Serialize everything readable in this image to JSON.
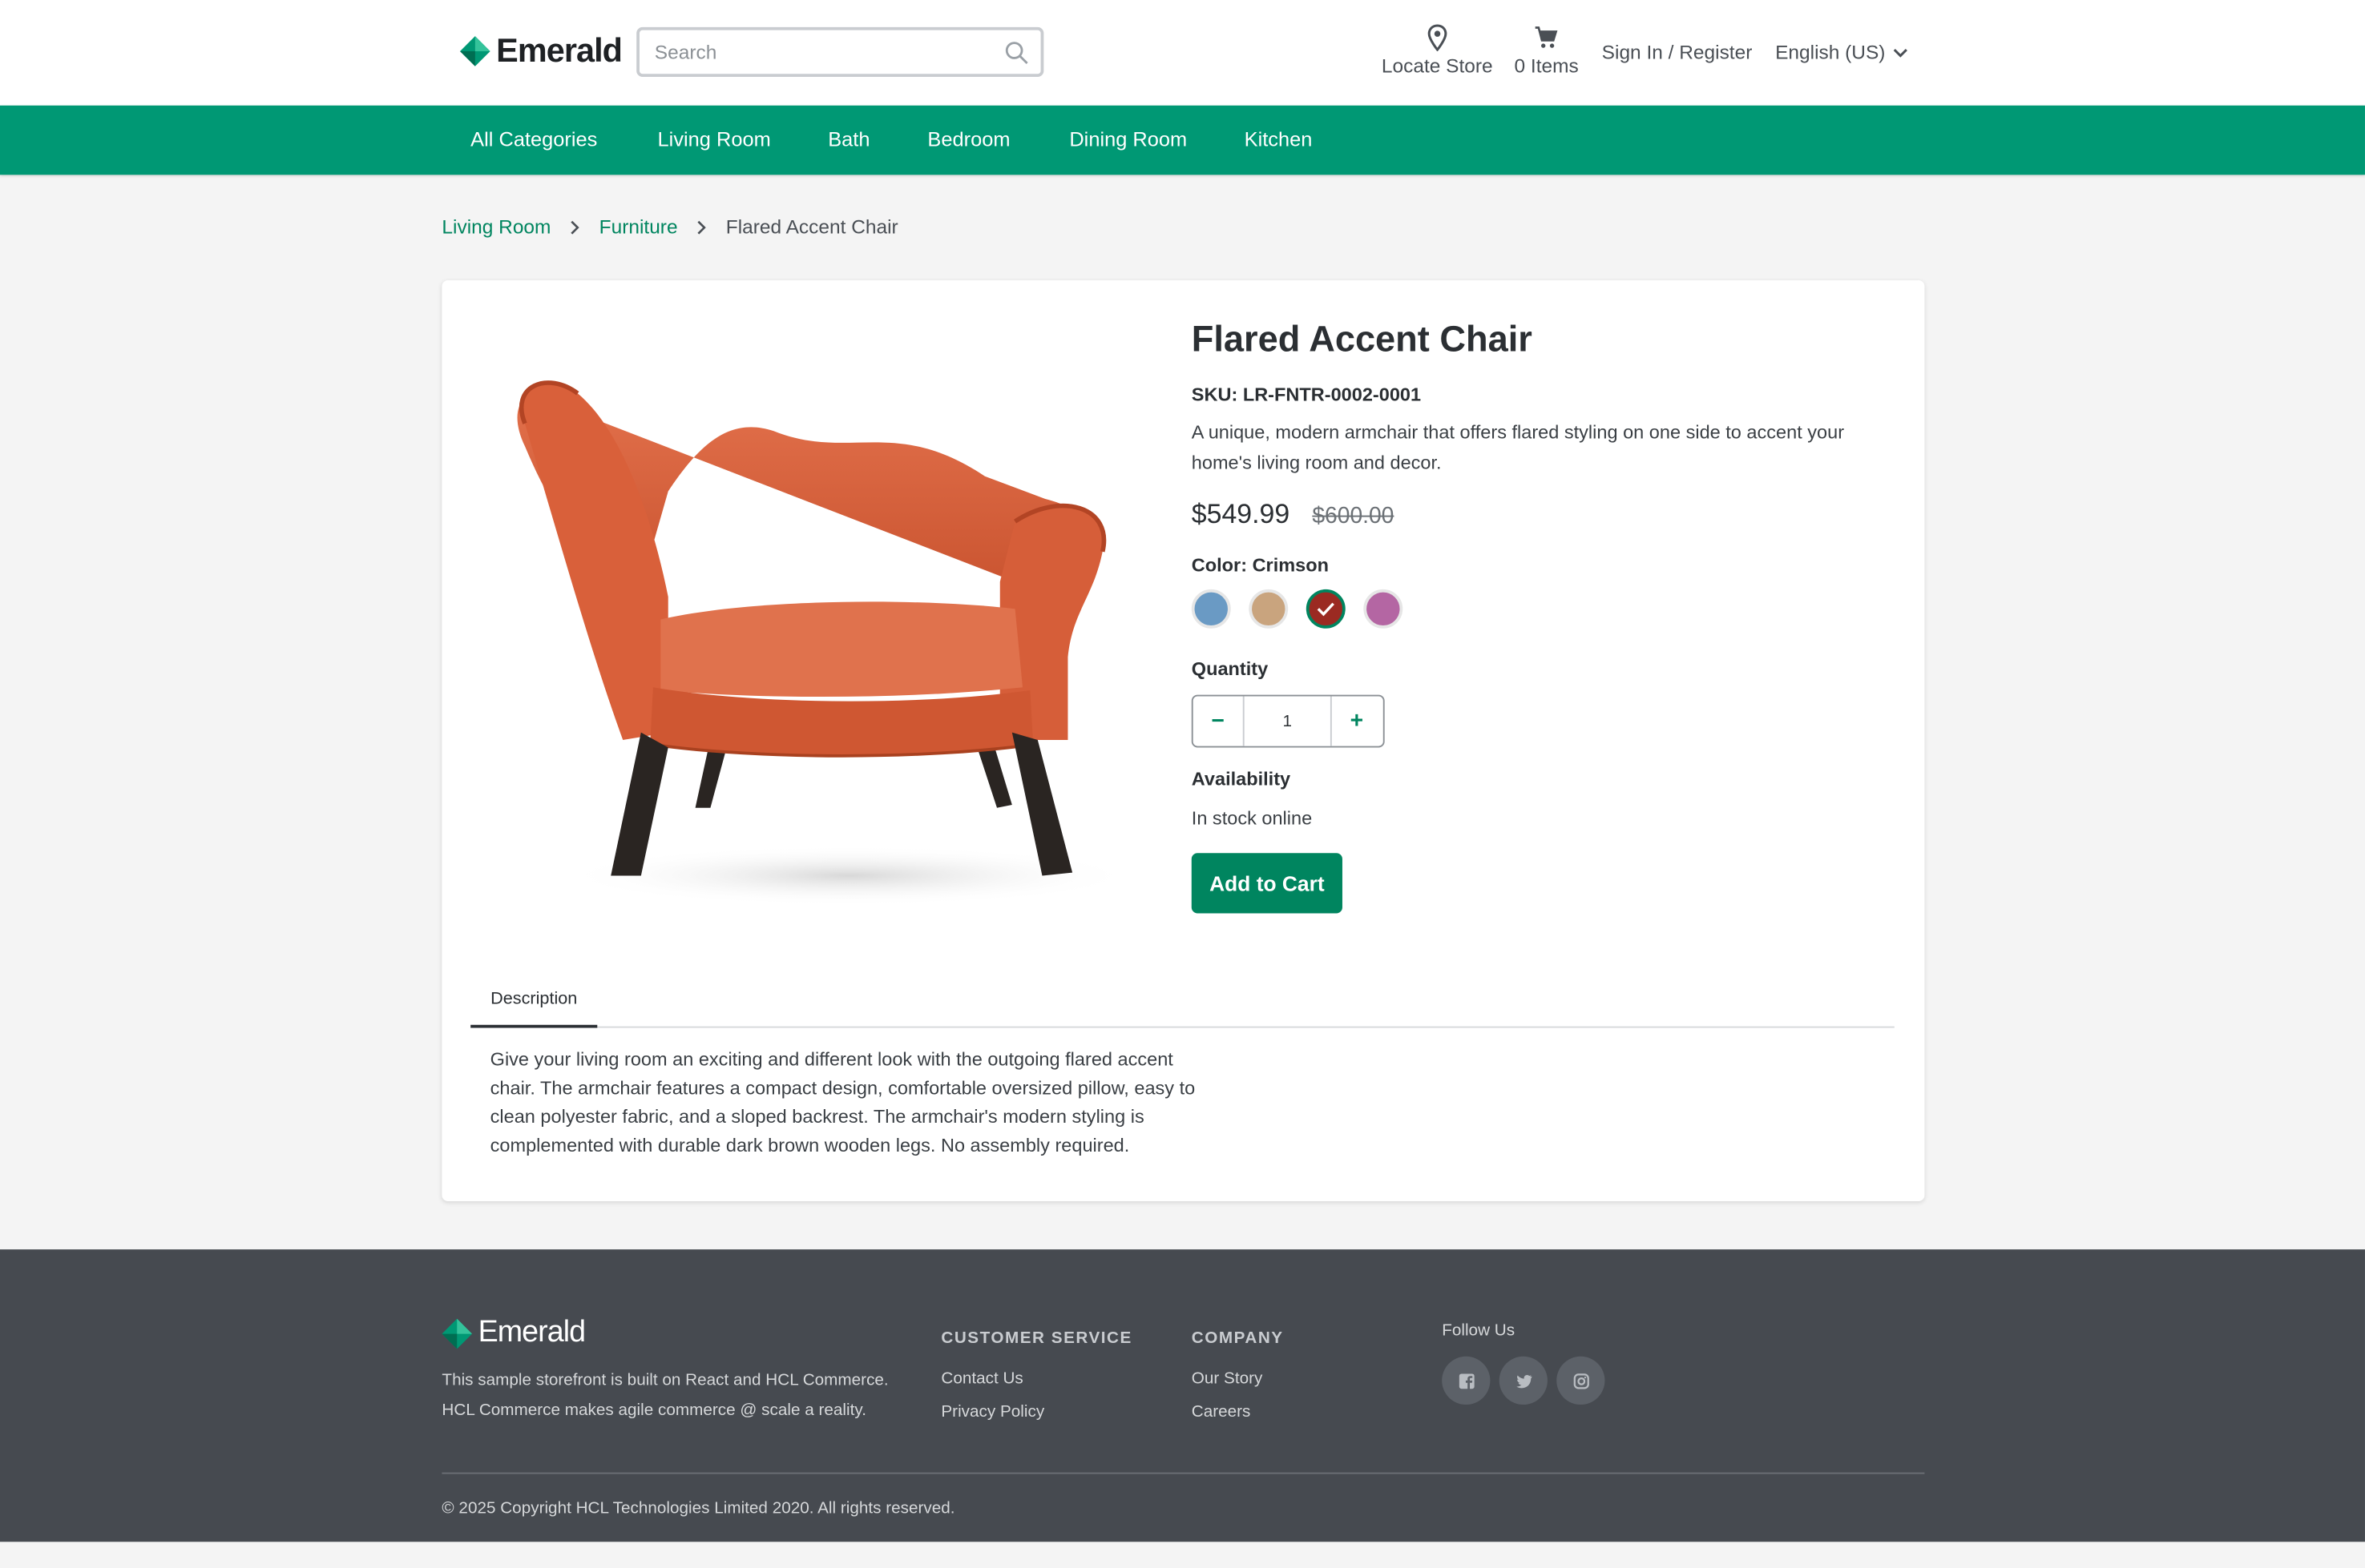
{
  "header": {
    "brand": "Emerald",
    "search_placeholder": "Search",
    "locate_label": "Locate Store",
    "cart_label": "0 Items",
    "signin_label": "Sign In / Register",
    "language_label": "English (US)"
  },
  "nav": {
    "items": [
      "All Categories",
      "Living Room",
      "Bath",
      "Bedroom",
      "Dining Room",
      "Kitchen"
    ]
  },
  "breadcrumb": {
    "items": [
      "Living Room",
      "Furniture",
      "Flared Accent Chair"
    ]
  },
  "product": {
    "title": "Flared Accent Chair",
    "sku": "SKU: LR-FNTR-0002-0001",
    "short_description": "A unique, modern armchair that offers flared styling on one side to accent your home's living room and decor.",
    "price": "$549.99",
    "original_price": "$600.00",
    "color_label": "Color: Crimson",
    "swatches": [
      {
        "color": "#6a9ac4",
        "selected": false
      },
      {
        "color": "#c9a47e",
        "selected": false
      },
      {
        "color": "#9b2a22",
        "selected": true
      },
      {
        "color": "#b466a3",
        "selected": false
      }
    ],
    "quantity_label": "Quantity",
    "quantity_value": "1",
    "decrement": "−",
    "increment": "+",
    "availability_label": "Availability",
    "availability_value": "In stock online",
    "add_to_cart": "Add to Cart",
    "tab_label": "Description",
    "long_description": "Give your living room an exciting and different look with the outgoing flared accent chair. The armchair features a compact design, comfortable oversized pillow, easy to clean polyester fabric, and a sloped backrest. The armchair's modern styling is complemented with durable dark brown wooden legs. No assembly required."
  },
  "footer": {
    "brand": "Emerald",
    "about": "This sample storefront is built on React and HCL Commerce. HCL Commerce makes agile commerce @ scale a reality.",
    "customer_service_heading": "CUSTOMER SERVICE",
    "customer_service_links": [
      "Contact Us",
      "Privacy Policy"
    ],
    "company_heading": "COMPANY",
    "company_links": [
      "Our Story",
      "Careers"
    ],
    "follow_label": "Follow Us",
    "social": [
      "facebook-icon",
      "twitter-icon",
      "instagram-icon"
    ],
    "copyright": "© 2025 Copyright HCL Technologies Limited 2020. All rights reserved."
  },
  "colors": {
    "brand_green": "#009874",
    "accent_green": "#00855f",
    "footer_bg": "#464a50"
  }
}
